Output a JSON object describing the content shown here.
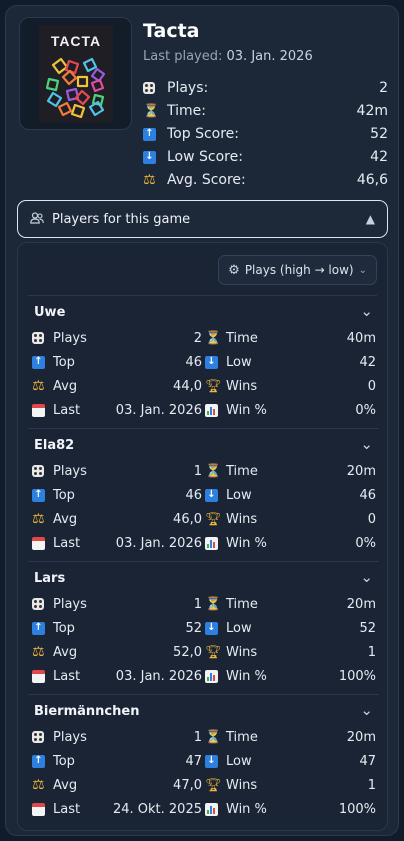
{
  "game": {
    "title": "Tacta",
    "cover_title": "TACTA",
    "last_played_label": "Last played:",
    "last_played_value": "03. Jan. 2026",
    "stats": [
      {
        "icon": "dice-icon",
        "label": "Plays:",
        "value": "2"
      },
      {
        "icon": "hourglass-icon",
        "label": "Time:",
        "value": "42m"
      },
      {
        "icon": "arrow-up-icon",
        "label": "Top Score:",
        "value": "52"
      },
      {
        "icon": "arrow-down-icon",
        "label": "Low Score:",
        "value": "42"
      },
      {
        "icon": "scales-icon",
        "label": "Avg. Score:",
        "value": "46,6"
      }
    ]
  },
  "players_toggle": {
    "label": "Players for this game",
    "expanded": true
  },
  "sort": {
    "label": "Plays (high → low)"
  },
  "labels": {
    "plays": "Plays",
    "time": "Time",
    "top": "Top",
    "low": "Low",
    "avg": "Avg",
    "wins": "Wins",
    "last": "Last",
    "win_pct": "Win %"
  },
  "players": [
    {
      "name": "Uwe",
      "plays": "2",
      "time": "40m",
      "top": "46",
      "low": "42",
      "avg": "44,0",
      "wins": "0",
      "last": "03. Jan. 2026",
      "win_pct": "0%"
    },
    {
      "name": "Ela82",
      "plays": "1",
      "time": "20m",
      "top": "46",
      "low": "46",
      "avg": "46,0",
      "wins": "0",
      "last": "03. Jan. 2026",
      "win_pct": "0%"
    },
    {
      "name": "Lars",
      "plays": "1",
      "time": "20m",
      "top": "52",
      "low": "52",
      "avg": "52,0",
      "wins": "1",
      "last": "03. Jan. 2026",
      "win_pct": "100%"
    },
    {
      "name": "Biermännchen",
      "plays": "1",
      "time": "20m",
      "top": "47",
      "low": "47",
      "avg": "47,0",
      "wins": "1",
      "last": "24. Okt. 2025",
      "win_pct": "100%"
    }
  ],
  "colors": {
    "background": "#121b2a",
    "card": "#1c2738",
    "accent_blue": "#2d7fe0",
    "accent_gold": "#f2b63a"
  }
}
